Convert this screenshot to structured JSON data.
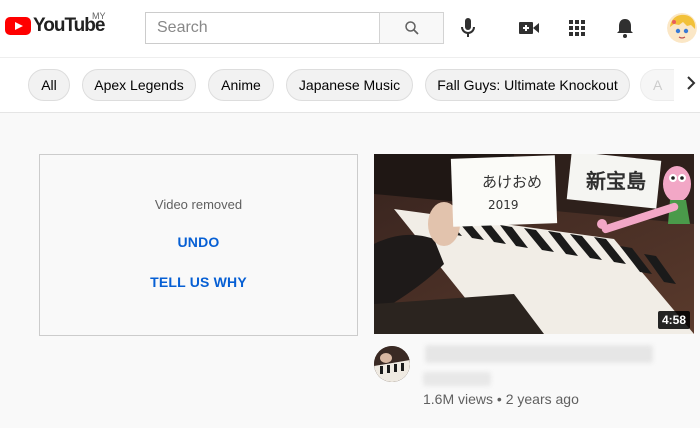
{
  "header": {
    "logo_text": "YouTube",
    "region": "MY",
    "search_placeholder": "Search"
  },
  "chips": [
    "All",
    "Apex Legends",
    "Anime",
    "Japanese Music",
    "Fall Guys: Ultimate Knockout",
    "A"
  ],
  "removed_card": {
    "message": "Video removed",
    "undo_label": "UNDO",
    "tell_us_label": "TELL US WHY"
  },
  "video": {
    "duration": "4:58",
    "views": "1.6M views",
    "separator": "•",
    "age": "2 years ago",
    "sign_text_1": "あけおめ",
    "sign_text_2": "2019",
    "sign_text_3": "新宝島"
  },
  "colors": {
    "brand_red": "#ff0000",
    "link_blue": "#065fd4"
  },
  "icons": [
    "search-icon",
    "microphone-icon",
    "create-video-icon",
    "apps-grid-icon",
    "notifications-bell-icon",
    "avatar",
    "chevron-right-icon"
  ]
}
